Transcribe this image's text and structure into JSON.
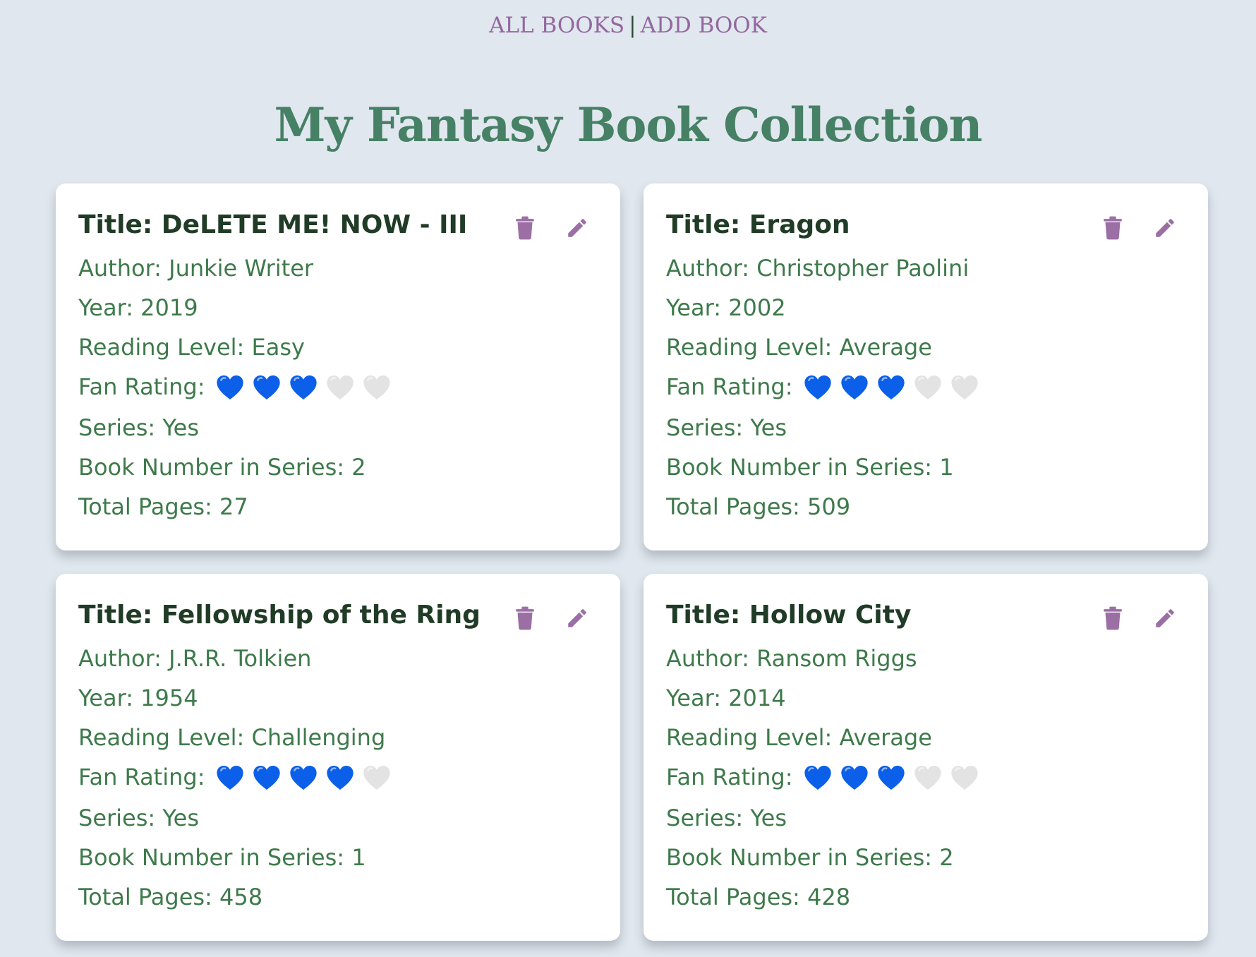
{
  "nav": {
    "all_books": "ALL BOOKS",
    "separator": "|",
    "add_book": "ADD BOOK"
  },
  "page_title": "My Fantasy Book Collection",
  "colors": {
    "heart_filled": "#0b5fe8",
    "heart_empty": "#e3e3e3",
    "icon": "#9b6fa4"
  },
  "books": [
    {
      "title": "Title: DeLETE ME! NOW - III",
      "author": "Author: Junkie Writer",
      "year": "Year: 2019",
      "reading_level": "Reading Level: Easy",
      "fan_rating_label": "Fan Rating:",
      "fan_rating": 3,
      "fan_rating_max": 5,
      "series": "Series: Yes",
      "book_number": "Book Number in Series: 2",
      "total_pages": "Total Pages: 27"
    },
    {
      "title": "Title: Eragon",
      "author": "Author: Christopher Paolini",
      "year": "Year: 2002",
      "reading_level": "Reading Level: Average",
      "fan_rating_label": "Fan Rating:",
      "fan_rating": 3,
      "fan_rating_max": 5,
      "series": "Series: Yes",
      "book_number": "Book Number in Series: 1",
      "total_pages": "Total Pages: 509"
    },
    {
      "title": "Title: Fellowship of the Ring",
      "author": "Author: J.R.R. Tolkien",
      "year": "Year: 1954",
      "reading_level": "Reading Level: Challenging",
      "fan_rating_label": "Fan Rating:",
      "fan_rating": 4,
      "fan_rating_max": 5,
      "series": "Series: Yes",
      "book_number": "Book Number in Series: 1",
      "total_pages": "Total Pages: 458"
    },
    {
      "title": "Title: Hollow City",
      "author": "Author: Ransom Riggs",
      "year": "Year: 2014",
      "reading_level": "Reading Level: Average",
      "fan_rating_label": "Fan Rating:",
      "fan_rating": 3,
      "fan_rating_max": 5,
      "series": "Series: Yes",
      "book_number": "Book Number in Series: 2",
      "total_pages": "Total Pages: 428"
    }
  ]
}
